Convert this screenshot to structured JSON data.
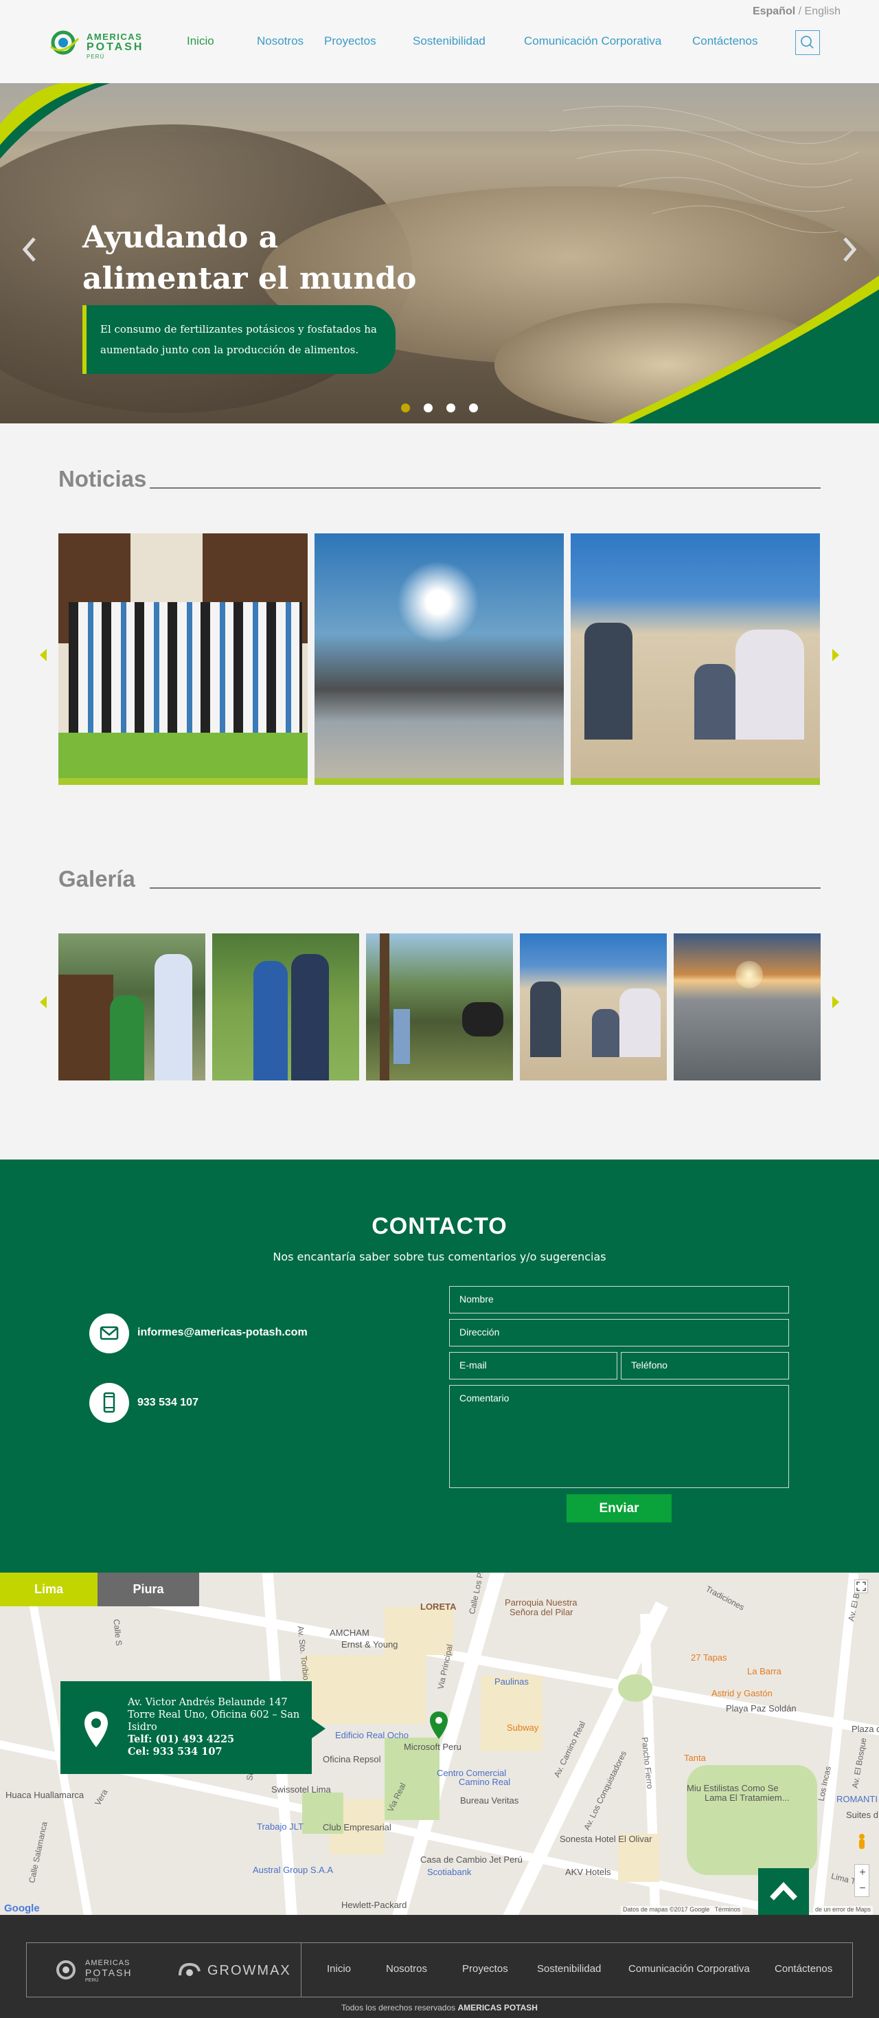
{
  "header": {
    "lang_active": "Español",
    "lang_sep": " / ",
    "lang_other": "English",
    "logo_line1": "AMERICAS",
    "logo_line2": "POTASH",
    "logo_line3": "PERÚ",
    "nav": [
      "Inicio",
      "Nosotros",
      "Proyectos",
      "Sostenibilidad",
      "Comunicación Corporativa",
      "Contáctenos"
    ],
    "search_icon": "search-icon"
  },
  "hero": {
    "title_line1": "Ayudando a",
    "title_line2": "alimentar el mundo",
    "text_line1": "El consumo de fertilizantes potásicos y fosfatados ha",
    "text_line2": "aumentado junto con la producción de alimentos.",
    "slide_count": 4,
    "active_slide": 1
  },
  "news": {
    "title": "Noticias"
  },
  "gallery": {
    "title": "Galería"
  },
  "contact": {
    "title": "CONTACTO",
    "subtitle": "Nos encantaría saber sobre tus comentarios y/o sugerencias",
    "email": "informes@americas-potash.com",
    "phone": "933 534 107",
    "form": {
      "name": "Nombre",
      "address": "Dirección",
      "email": "E-mail",
      "phone": "Teléfono",
      "comment": "Comentario",
      "submit": "Enviar"
    }
  },
  "map": {
    "tabs": [
      "Lima",
      "Piura"
    ],
    "address_line1": "Av. Victor Andrés Belaunde 147",
    "address_line2": "Torre Real Uno, Oficina 602 – San",
    "address_line3": "Isidro",
    "address_tel": "Telf: (01) 493 4225",
    "address_cel": "Cel: 933 534 107",
    "pois": [
      "LORETA",
      "Parroquia Nuestra",
      "Señora del Pilar",
      "AMCHAM",
      "Ernst & Young",
      "Paulinas",
      "27 Tapas",
      "La Barra",
      "Astrid y Gastón",
      "Playa Paz Soldán",
      "Subway",
      "Edificio Real Ocho",
      "Microsoft Peru",
      "Oficina Repsol",
      "Centro Comercial",
      "Camino Real",
      "Tanta",
      "Swissotel Lima",
      "Bureau Veritas",
      "Miu Estilistas Como Se",
      "Lama El Tratamiem...",
      "Trabajo JLT",
      "Club Empresarial",
      "Huaca Huallamarca",
      "Casa de Cambio Jet Perú",
      "Scotiabank",
      "Sonesta Hotel El Olivar",
      "AKV Hotels",
      "Austral Group S.A.A",
      "Hewlett-Packard",
      "ROMANTI",
      "Plaza d",
      "Suites d"
    ],
    "streets": [
      "Av. Sto. Toribio",
      "Calle S",
      "Via Principal",
      "Calle Los Pa",
      "Tradiciones",
      "Av. El Bo",
      "Av. Camino Real",
      "Av. Los Conquistadores",
      "Pancho Fierro",
      "Los Incas",
      "Via Real",
      "Calle Salamanca",
      "Vera",
      "Av. El Bosque",
      "Sucre",
      "Lima Tarr"
    ],
    "credits": "Datos de mapas ©2017 Google",
    "terms": "Términos",
    "report": "de un error de Maps",
    "google": "Google"
  },
  "footer": {
    "logo1_line1": "AMERICAS",
    "logo1_line2": "POTASH",
    "logo1_line3": "PERÚ",
    "logo2": "GROWMAX",
    "nav": [
      "Inicio",
      "Nosotros",
      "Proyectos",
      "Sostenibilidad",
      "Comunicación Corporativa",
      "Contáctenos"
    ],
    "copyright_prefix": "Todos los derechos reservados",
    "copyright_brand": "AMERICAS POTASH"
  },
  "colors": {
    "brand_green": "#006b45",
    "accent_lime": "#c2d500",
    "link_blue": "#3a9bc6",
    "button_green": "#0aa23a"
  }
}
